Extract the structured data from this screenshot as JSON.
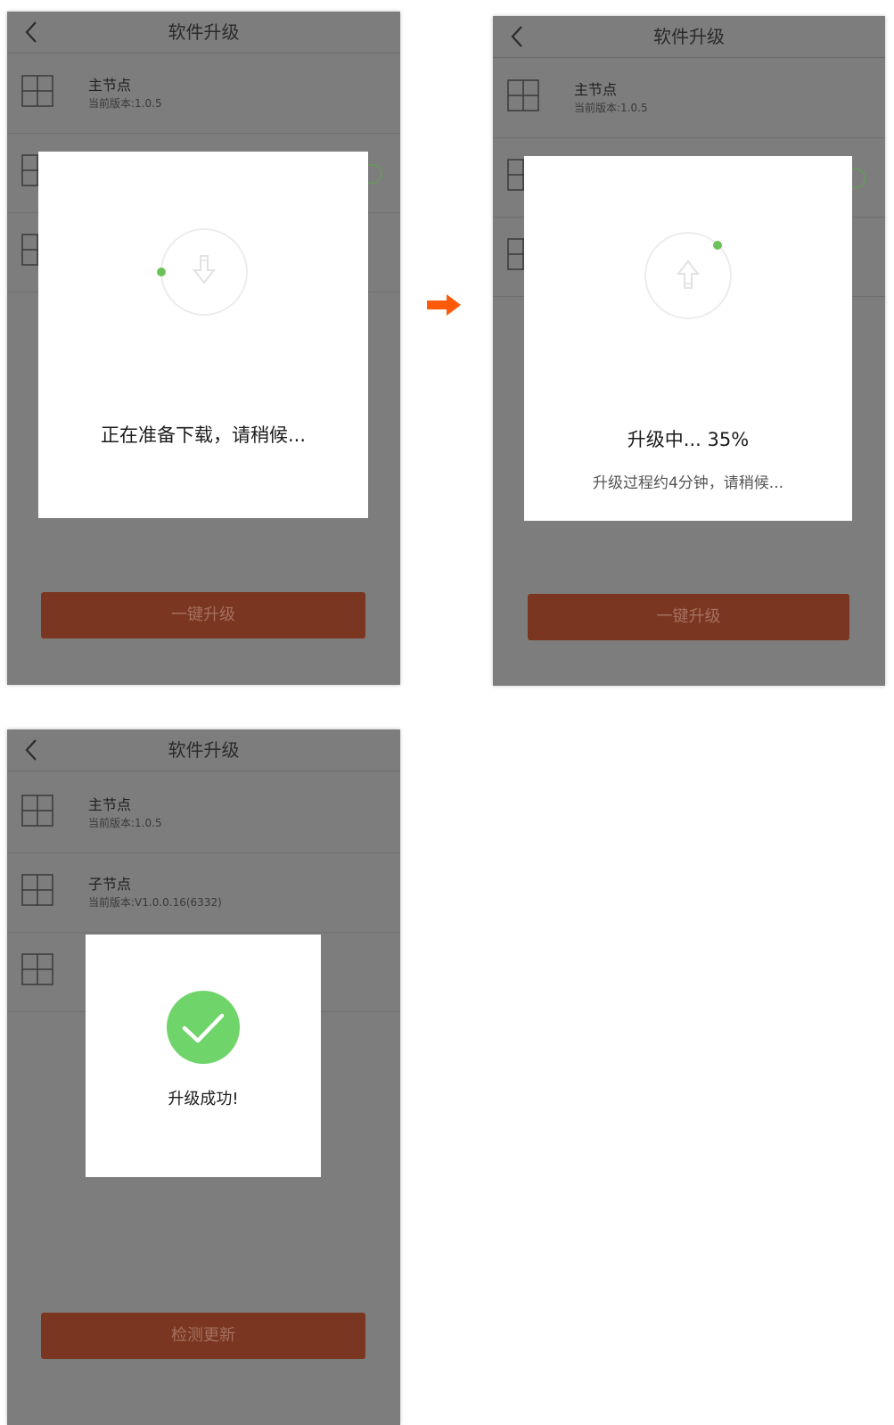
{
  "screens": [
    {
      "header": {
        "title": "软件升级"
      },
      "devices": [
        {
          "name": "主节点",
          "version": "当前版本:1.0.5"
        }
      ],
      "modal": {
        "message": "正在准备下载，请稍候..."
      },
      "action_button": "一键升级"
    },
    {
      "header": {
        "title": "软件升级"
      },
      "devices": [
        {
          "name": "主节点",
          "version": "当前版本:1.0.5"
        }
      ],
      "modal": {
        "message": "升级中... 35%",
        "sub": "升级过程约4分钟，请稍候...",
        "progress_percent": 35
      },
      "action_button": "一键升级"
    },
    {
      "header": {
        "title": "软件升级"
      },
      "devices": [
        {
          "name": "主节点",
          "version": "当前版本:1.0.5"
        },
        {
          "name": "子节点",
          "version": "当前版本:V1.0.0.16(6332)"
        }
      ],
      "modal": {
        "message": "升级成功!"
      },
      "action_button": "检测更新"
    }
  ],
  "icons": {
    "back": "chevron-left-icon",
    "device": "grid-icon",
    "download": "download-arrow-icon",
    "upload": "upload-arrow-icon",
    "success": "check-icon",
    "flow": "right-arrow-icon"
  },
  "colors": {
    "overlay": "#7d7d7d",
    "accent_green": "#6cc25a",
    "button": "#7a3620",
    "flow_arrow": "#ff5a0a",
    "success": "#6fd46a"
  }
}
